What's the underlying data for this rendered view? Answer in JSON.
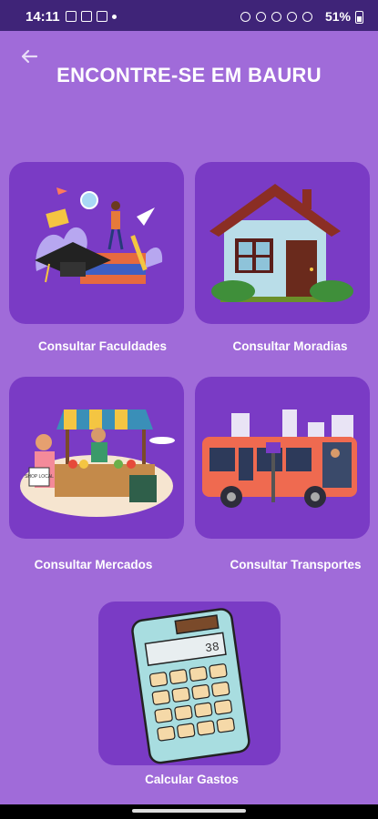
{
  "status_bar": {
    "time": "14:11",
    "battery": "51%"
  },
  "header": {
    "title": "ENCONTRE-SE EM BAURU"
  },
  "cards": [
    {
      "label": "Consultar Faculdades",
      "icon": "graduation-illustration"
    },
    {
      "label": "Consultar Moradias",
      "icon": "house-illustration"
    },
    {
      "label": "Consultar Mercados",
      "icon": "market-illustration"
    },
    {
      "label": "Consultar Transportes",
      "icon": "bus-illustration"
    },
    {
      "label": "Calcular Gastos",
      "icon": "calculator-illustration"
    }
  ],
  "illustration_text": {
    "market_sign": "SHOP LOCAL",
    "calculator_display": "38"
  },
  "colors": {
    "background": "#a06bd9",
    "card": "#7a3bc5",
    "status_bar": "#3f2478"
  }
}
